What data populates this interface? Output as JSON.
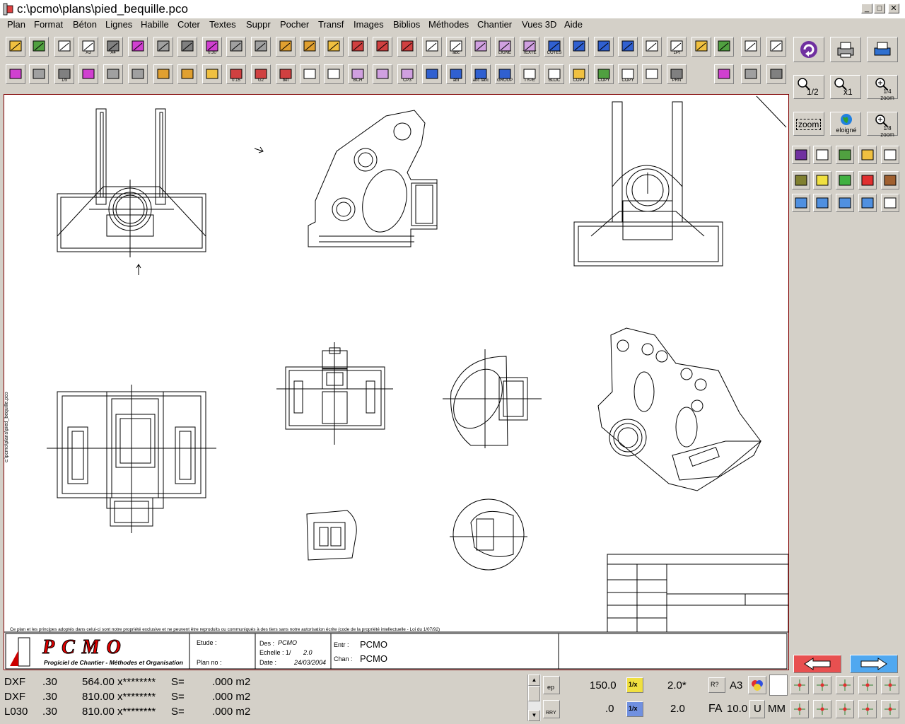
{
  "window": {
    "title": "c:\\pcmo\\plans\\pied_bequille.pco"
  },
  "menu": [
    "Plan",
    "Format",
    "Béton",
    "Lignes",
    "Habille",
    "Coter",
    "Textes",
    "Suppr",
    "Pocher",
    "Transf",
    "Images",
    "Biblios",
    "Méthodes",
    "Chantier",
    "Vues 3D",
    "Aide"
  ],
  "toolbar": {
    "row1_labels": [
      "A3",
      "A4",
      "0.30",
      "abc",
      "LIGNE",
      "TEXTE",
      "COTES",
      "1Pt"
    ],
    "row2_labels": [
      "1/x",
      "0.15",
      "G2",
      "bet",
      "BCH",
      "CP3",
      "abI",
      "abc tabc",
      "GROUP",
      "TYPE",
      "BLOC",
      "COPY",
      "COPY",
      "COPY",
      "PRN"
    ]
  },
  "side": {
    "zoom_half": "1/2",
    "zoom_x1": "x1",
    "zoom_quarter": "1/4 zoom",
    "zoom_label": "zoom",
    "eloigne": "eloigné",
    "zoom_eighth": "1/8 zoom"
  },
  "drawing": {
    "side_label": "c:\\pcmo\\plans\\pied_bequille.pco",
    "copyright": "Ce plan et les principes adoptés dans celui-ci sont notre propriété exclusive et ne peuvent être reproduits ou communiqués à des tiers sans notre autorisation écrite (code de la propriété intellectuelle - Loi du 1/07/92)",
    "logo_text": "PCMO",
    "logo_sub": "Progiciel de Chantier - Méthodes et Organisation",
    "etude_label": "Etude :",
    "plan_label": "Plan no :",
    "des_label": "Des :",
    "des_value": "PCMO",
    "echelle_label": "Echelle : 1/",
    "echelle_value": "2.0",
    "date_label": "Date :",
    "date_value": "24/03/2004",
    "entr_label": "Entr :",
    "entr_value": "PCMO",
    "chan_label": "Chan :",
    "chan_value": "PCMO"
  },
  "status": {
    "lines": [
      {
        "type": "DXF",
        "a": ".30",
        "b": "564.00 x********",
        "s": "S=",
        "v": ".000 m2"
      },
      {
        "type": "DXF",
        "a": ".30",
        "b": "810.00 x********",
        "s": "S=",
        "v": ".000 m2"
      },
      {
        "type": "L030",
        "a": ".30",
        "b": "810.00 x********",
        "s": "S=",
        "v": ".000 m2"
      }
    ]
  },
  "bottom": {
    "ep": "ep",
    "rry": "RRY",
    "v1": "150.0",
    "v2": ".0",
    "recip1": "1/x",
    "recip2": "1/x",
    "scale1": "2.0*",
    "scale2": "2.0",
    "a3": "A3",
    "fa": "FA",
    "fa_val": "10.0",
    "u": "U",
    "mm": "MM",
    "ra": "R?"
  },
  "colors": {
    "frame": "#800000",
    "accent_red": "#e85050",
    "accent_blue": "#50a8f0"
  }
}
